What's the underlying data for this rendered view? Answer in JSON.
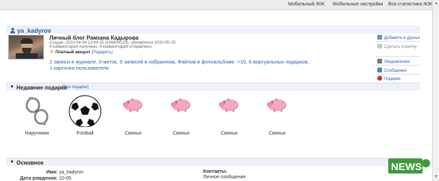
{
  "topnav": {
    "items": [
      "Мобильный ЖЖ",
      "Мобильные настройки",
      "Вся статистика ЖЖ"
    ]
  },
  "profile": {
    "username": "ya_kadyrov",
    "blog_title": "Личный блог Рамзана Кадырова",
    "created": "Создан: 2010-04-04 13:44:15 (#26604123), обновлялся 2010-05-25",
    "comments": "4 комментария получено, 4 комментария отправлено",
    "paid_account": "Платный аккаунт",
    "gift_link": "[Подарить]",
    "stats": "2 записи в журнале, 0 меток, 0 записей в избранном, Файлов в фотоальбоме: <10, 6 виртуальных подарков, 1 карточка пользователя"
  },
  "actions": {
    "add_friend": "Добавить в друзья",
    "bookmark": "Сделать пометку",
    "notifications": "Уведомления",
    "message": "Сообщение",
    "gifts": "Подарки"
  },
  "gifts_section": {
    "title": "Недавние подарки",
    "all_link": "[Все подарки]",
    "items": [
      {
        "label": "Наручники",
        "icon": "handcuffs-icon"
      },
      {
        "label": "Football",
        "icon": "football-icon"
      },
      {
        "label": "Свинья",
        "icon": "pig-icon"
      },
      {
        "label": "Свинья",
        "icon": "pig-icon"
      },
      {
        "label": "Свинья",
        "icon": "pig-icon"
      },
      {
        "label": "Свинья",
        "icon": "pig-icon"
      }
    ]
  },
  "basic_section": {
    "title": "Основное",
    "name_label": "Имя:",
    "name_value": "ya_kadyrov",
    "birth_label": "Дата рождения:",
    "birth_value": "10-05",
    "contacts_label": "Контакты:",
    "contacts_value": "Личное сообщение"
  },
  "colors": {
    "link": "#2a5db0",
    "section_bg": "#eef1f7",
    "pig": "#f2a7c3"
  },
  "watermark": "NEWS"
}
